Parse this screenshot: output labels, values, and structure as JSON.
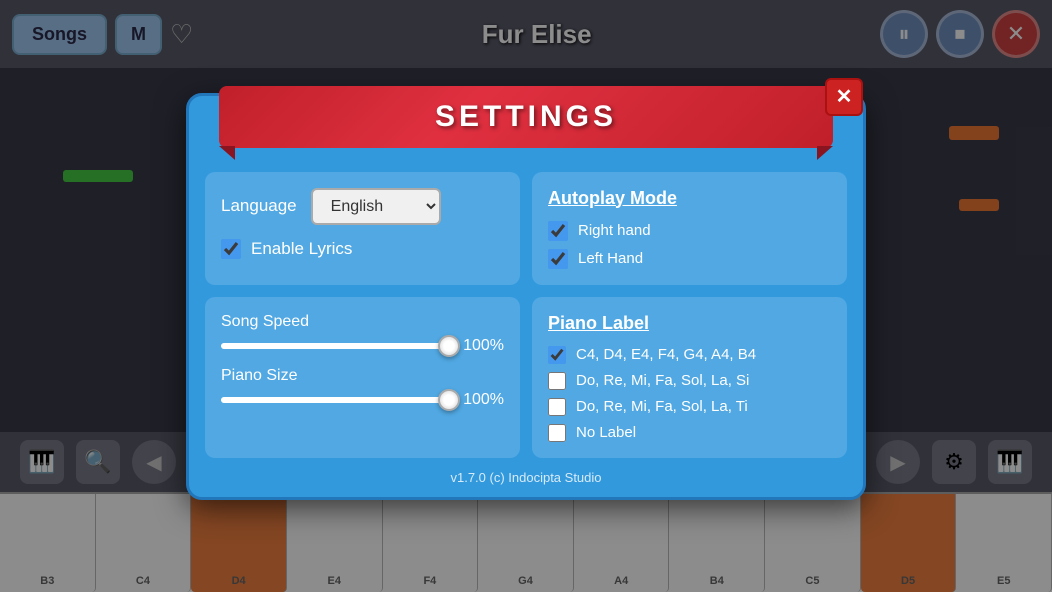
{
  "header": {
    "songs_label": "Songs",
    "m_label": "M",
    "title": "Fur Elise",
    "pause_icon": "⏸",
    "stop_icon": "⏹",
    "close_icon": "✕"
  },
  "piano_keys": {
    "keys": [
      "C4",
      "D4",
      "E4",
      "F4",
      "G4",
      "A4",
      "B4",
      "C5",
      "D5",
      "E5"
    ]
  },
  "settings": {
    "title": "SETTINGS",
    "close_label": "✕",
    "language_label": "Language",
    "language_value": "English",
    "enable_lyrics_label": "Enable Lyrics",
    "autoplay_title": "Autoplay Mode",
    "right_hand_label": "Right hand",
    "left_hand_label": "Left Hand",
    "song_speed_label": "Song Speed",
    "song_speed_value": "100%",
    "piano_size_label": "Piano Size",
    "piano_size_value": "100%",
    "piano_label_title": "Piano Label",
    "label_option1": "C4, D4, E4, F4, G4, A4, B4",
    "label_option2": "Do, Re, Mi, Fa, Sol, La, Si",
    "label_option3": "Do, Re, Mi, Fa, Sol, La, Ti",
    "label_option4": "No Label",
    "version": "v1.7.0 (c) Indocipta Studio"
  },
  "toolbar": {
    "piano_icon": "🎹",
    "search_icon": "🔍",
    "gear_icon": "⚙",
    "piano_icon2": "🎹"
  }
}
